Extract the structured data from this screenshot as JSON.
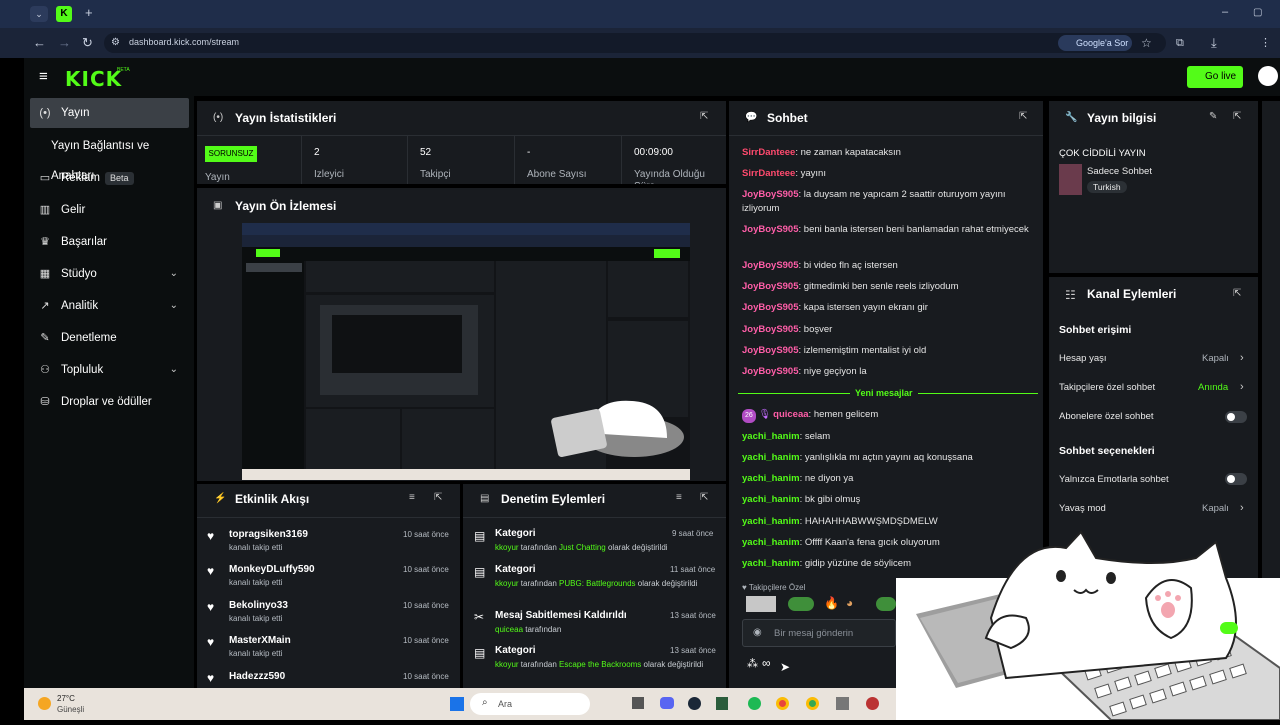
{
  "browser": {
    "url": "dashboard.kick.com/stream",
    "google_button": "Google'a Sor"
  },
  "header": {
    "logo": "KICK",
    "logo_beta": "BETA",
    "go_live": "Go live"
  },
  "sidebar": {
    "items": [
      {
        "label": "Yayın",
        "icon": "broadcast-icon"
      },
      {
        "label": "Yayın Bağlantısı ve Anahtarı"
      },
      {
        "label": "Reklam",
        "badge": "Beta",
        "icon": "ad-icon"
      },
      {
        "label": "Gelir",
        "icon": "revenue-icon"
      },
      {
        "label": "Başarılar",
        "icon": "trophy-icon"
      },
      {
        "label": "Stüdyo",
        "icon": "studio-icon"
      },
      {
        "label": "Analitik",
        "icon": "analytics-icon"
      },
      {
        "label": "Denetleme",
        "icon": "wrench-icon"
      },
      {
        "label": "Topluluk",
        "icon": "community-icon"
      },
      {
        "label": "Droplar ve ödüller",
        "icon": "drops-icon"
      }
    ]
  },
  "stats": {
    "title": "Yayın İstatistikleri",
    "status_badge": "SORUNSUZ",
    "status_label": "Yayın",
    "viewers_value": "2",
    "viewers_label": "İzleyici",
    "followers_value": "52",
    "followers_label": "Takipçi",
    "subs_value": "-",
    "subs_label": "Abone Sayısı",
    "duration_value": "00:09:00",
    "duration_label": "Yayında Olduğu Süre"
  },
  "preview": {
    "title": "Yayın Ön İzlemesi"
  },
  "chat": {
    "title": "Sohbet",
    "messages_before": [
      {
        "user": "SirrDanteee",
        "text": "ne zaman kapatacaksın",
        "color": "red"
      },
      {
        "user": "SirrDanteee",
        "text": "yayını",
        "color": "red"
      },
      {
        "user": "JoyBoyS905",
        "text": "la duysam ne yapıcam 2 saattir oturuyom yayını izliyorum",
        "color": "pink"
      },
      {
        "user": "JoyBoyS905",
        "text": "beni banla istersen beni banlamadan rahat etmiyecek",
        "color": "pink"
      },
      {
        "user": "JoyBoyS905",
        "text": "bi video fln aç istersen",
        "color": "pink"
      },
      {
        "user": "JoyBoyS905",
        "text": "gitmedimki ben senle reels izliyodum",
        "color": "pink"
      },
      {
        "user": "JoyBoyS905",
        "text": "kapa istersen yayın ekranı gir",
        "color": "pink"
      },
      {
        "user": "JoyBoyS905",
        "text": "boşver",
        "color": "pink"
      },
      {
        "user": "JoyBoyS905",
        "text": "izlememiştim mentalist iyi old",
        "color": "pink"
      },
      {
        "user": "JoyBoyS905",
        "text": "niye geçiyon la",
        "color": "pink"
      }
    ],
    "new_messages_label": "Yeni mesajlar",
    "messages_after": [
      {
        "user": "quiceaa",
        "text": "hemen gelicem",
        "color": "pink",
        "badge": "26"
      },
      {
        "user": "yachi_hanim",
        "text": "selam",
        "color": "green"
      },
      {
        "user": "yachi_hanim",
        "text": "yanlışlıkla mı açtın yayını aq konuşsana",
        "color": "green"
      },
      {
        "user": "yachi_hanim",
        "text": "ne diyon ya",
        "color": "green"
      },
      {
        "user": "yachi_hanim",
        "text": "bk gibi olmuş",
        "color": "green"
      },
      {
        "user": "yachi_hanim",
        "text": "HAHAHHABWWŞMDŞDMELW",
        "color": "green"
      },
      {
        "user": "yachi_hanim",
        "text": "Offff Kaan'a fena gıcık oluyorum",
        "color": "green"
      },
      {
        "user": "yachi_hanim",
        "text": "gidip yüzüne de söylicem",
        "color": "green"
      }
    ],
    "followers_only": "Takipçilere Özel",
    "input_placeholder": "Bir mesaj gönderin",
    "footer_count": "∞"
  },
  "stream_info": {
    "title": "Yayın bilgisi",
    "stream_title": "ÇOK CİDDİLİ YAYIN",
    "category": "Sadece Sohbet",
    "tag": "Turkish"
  },
  "channel_actions": {
    "title": "Kanal Eylemleri",
    "section_access": "Sohbet erişimi",
    "rows_access": [
      {
        "label": "Hesap yaşı",
        "value": "Kapalı"
      },
      {
        "label": "Takipçilere özel sohbet",
        "value": "Anında"
      },
      {
        "label": "Abonelere özel sohbet",
        "value": ""
      }
    ],
    "section_options": "Sohbet seçenekleri",
    "rows_options": [
      {
        "label": "Yalnızca Emotlarla sohbet",
        "value": ""
      },
      {
        "label": "Yavaş mod",
        "value": "Kapalı"
      }
    ]
  },
  "activity": {
    "title": "Etkinlik Akışı",
    "items": [
      {
        "user": "topragsiken3169",
        "action": "kanalı takip etti",
        "time": "10 saat önce"
      },
      {
        "user": "MonkeyDLuffy590",
        "action": "kanalı takip etti",
        "time": "10 saat önce"
      },
      {
        "user": "Bekolinyo33",
        "action": "kanalı takip etti",
        "time": "10 saat önce"
      },
      {
        "user": "MasterXMain",
        "action": "kanalı takip etti",
        "time": "10 saat önce"
      },
      {
        "user": "Hadezzz590",
        "action": "",
        "time": "10 saat önce"
      }
    ]
  },
  "moderation": {
    "title": "Denetim Eylemleri",
    "items": [
      {
        "title": "Kategori",
        "time": "9 saat önce",
        "actor": "kkoyur",
        "pre": " tarafından ",
        "target": "Just Chatting",
        "post": " olarak değiştirildi"
      },
      {
        "title": "Kategori",
        "time": "11 saat önce",
        "actor": "kkoyur",
        "pre": " tarafından ",
        "target": "PUBG: Battlegrounds",
        "post": " olarak değiştirildi"
      },
      {
        "title": "Mesaj Sabitlemesi Kaldırıldı",
        "time": "13 saat önce",
        "actor": "quiceaa",
        "pre": " tarafından",
        "target": "",
        "post": ""
      },
      {
        "title": "Kategori",
        "time": "13 saat önce",
        "actor": "kkoyur",
        "pre": " tarafından ",
        "target": "Escape the Backrooms",
        "post": " olarak değiştirildi"
      }
    ]
  },
  "taskbar": {
    "temp": "27°C",
    "weather": "Güneşli",
    "search": "Ara"
  }
}
